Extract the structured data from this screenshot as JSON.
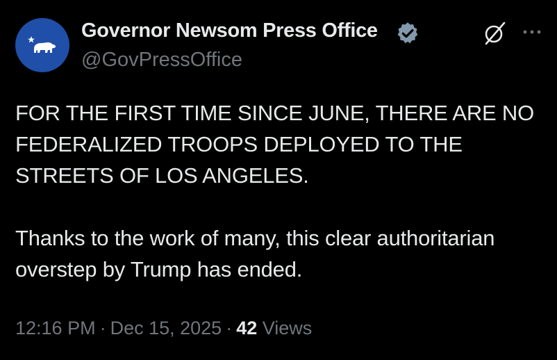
{
  "account": {
    "display_name": "Governor Newsom Press Office",
    "handle": "@GovPressOffice",
    "verified_badge_color": "#829aab",
    "avatar_color": "#1f4fa8",
    "avatar_icon": "california-bear-icon"
  },
  "actions": {
    "grok_icon": "grok-icon",
    "more_icon": "more-options-icon"
  },
  "tweet": {
    "paragraphs": [
      "FOR THE FIRST TIME SINCE JUNE, THERE ARE NO FEDERALIZED TROOPS DEPLOYED TO THE STREETS OF LOS ANGELES.",
      "Thanks to the work of many, this clear authoritarian overstep by Trump has ended."
    ]
  },
  "meta": {
    "time": "12:16 PM",
    "date": "Dec 15, 2025",
    "views_count": "42",
    "views_label": "Views",
    "separator": "·"
  },
  "colors": {
    "background": "#000000",
    "text_primary": "#e7e9ea",
    "text_secondary": "#71767b"
  }
}
